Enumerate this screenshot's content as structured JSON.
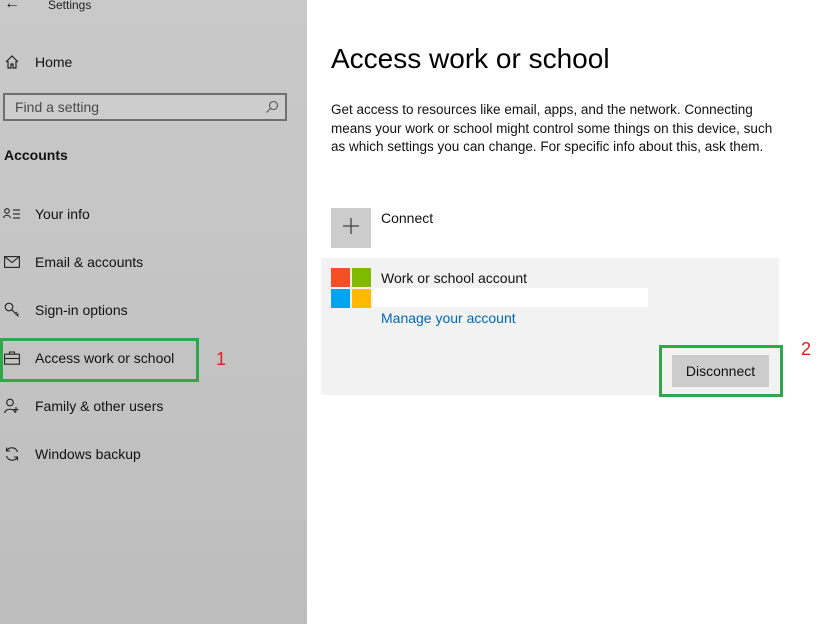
{
  "window": {
    "title": "Settings"
  },
  "sidebar": {
    "home_label": "Home",
    "search_placeholder": "Find a setting",
    "section_title": "Accounts",
    "items": [
      {
        "label": "Your info",
        "icon": "person-card-icon"
      },
      {
        "label": "Email & accounts",
        "icon": "mail-icon"
      },
      {
        "label": "Sign-in options",
        "icon": "key-icon"
      },
      {
        "label": "Access work or school",
        "icon": "briefcase-icon",
        "selected": true
      },
      {
        "label": "Family & other users",
        "icon": "person-add-icon"
      },
      {
        "label": "Windows backup",
        "icon": "sync-icon"
      }
    ]
  },
  "main": {
    "title": "Access work or school",
    "description": "Get access to resources like email, apps, and the network. Connecting means your work or school might control some things on this device, such as which settings you can change. For specific info about this, ask them.",
    "connect_label": "Connect",
    "account": {
      "title": "Work or school account",
      "manage_link": "Manage your account",
      "disconnect_label": "Disconnect",
      "logo_colors": [
        "#f25022",
        "#7fba00",
        "#00a4ef",
        "#ffb900"
      ]
    }
  },
  "annotations": {
    "step1": "1",
    "step2": "2",
    "box_color": "#2ea84a",
    "number_color": "#e02020"
  }
}
